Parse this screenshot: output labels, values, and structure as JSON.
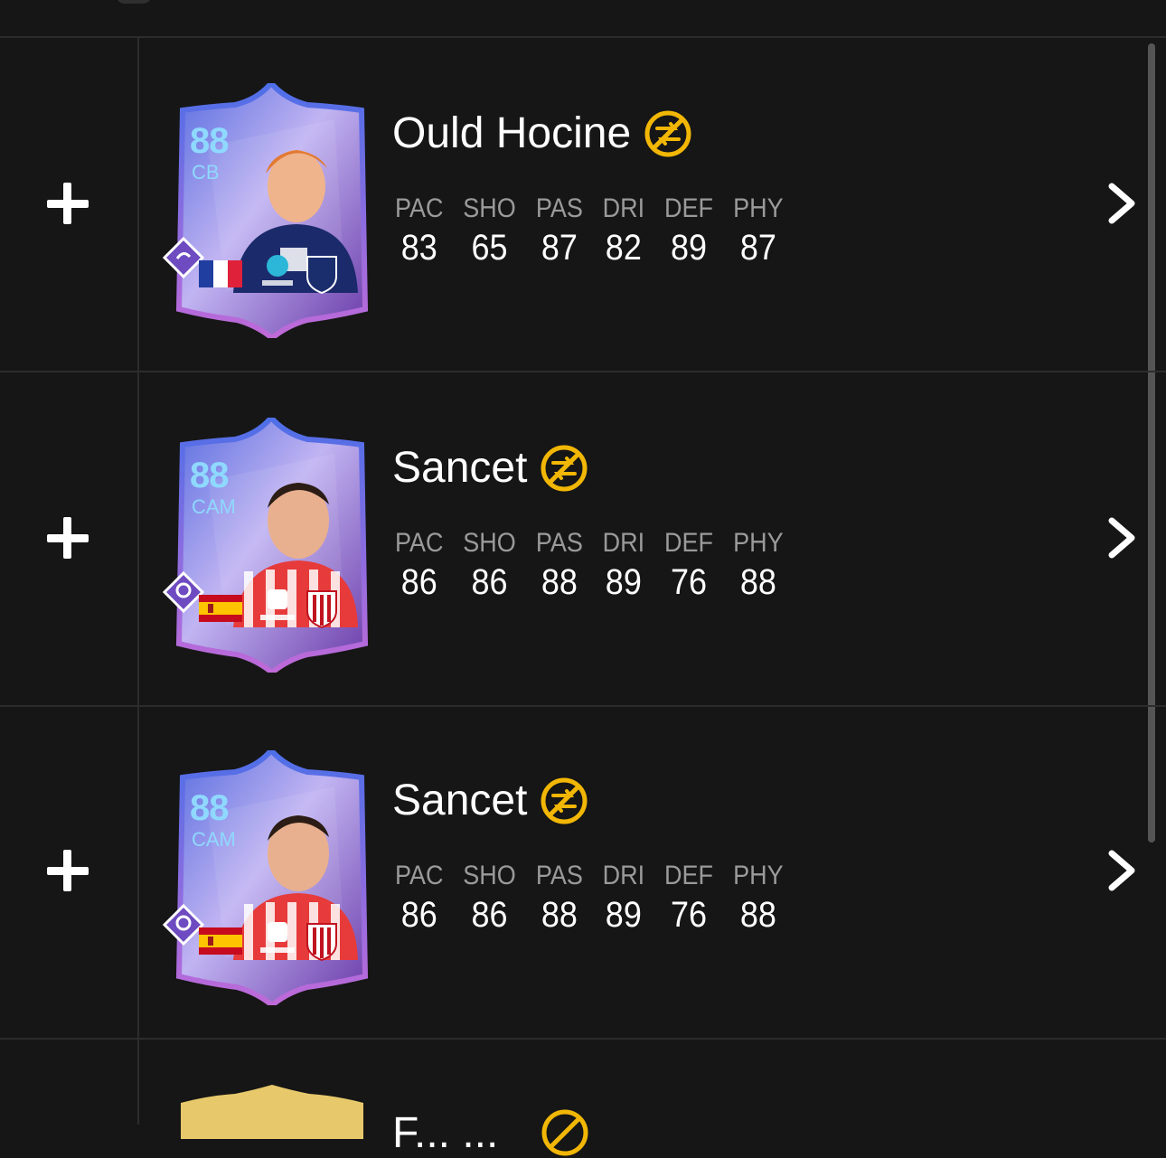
{
  "colors": {
    "background": "#161616",
    "divider": "#2c2c2c",
    "stat_label": "#9a9a9a",
    "accent_gold": "#f2b705",
    "card_rating": "#8fd8ff"
  },
  "stat_labels": [
    "PAC",
    "SHO",
    "PAS",
    "DRI",
    "DEF",
    "PHY"
  ],
  "rows": [
    {
      "name": "Ould Hocine",
      "rating": "88",
      "position": "CB",
      "flag": "france",
      "stats": [
        "83",
        "65",
        "87",
        "82",
        "89",
        "87"
      ],
      "icons": [
        "plus-icon",
        "untradeable-icon",
        "chevron-right-icon"
      ]
    },
    {
      "name": "Sancet",
      "rating": "88",
      "position": "CAM",
      "flag": "spain",
      "stats": [
        "86",
        "86",
        "88",
        "89",
        "76",
        "88"
      ],
      "icons": [
        "plus-icon",
        "untradeable-icon",
        "chevron-right-icon"
      ]
    },
    {
      "name": "Sancet",
      "rating": "88",
      "position": "CAM",
      "flag": "spain",
      "stats": [
        "86",
        "86",
        "88",
        "89",
        "76",
        "88"
      ],
      "icons": [
        "plus-icon",
        "untradeable-icon",
        "chevron-right-icon"
      ]
    }
  ],
  "partial_row": {
    "name": "F... ..."
  }
}
